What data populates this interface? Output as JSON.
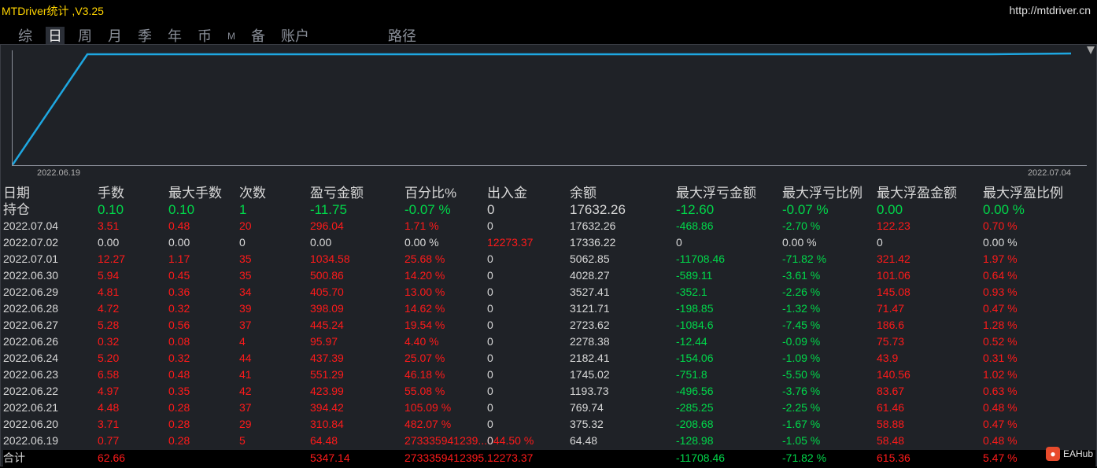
{
  "app": {
    "title": "MTDriver统计 ,V3.25",
    "url": "http://mtdriver.cn"
  },
  "tabs": [
    "综",
    "日",
    "周",
    "月",
    "季",
    "年",
    "币",
    "M",
    "备",
    "账户",
    "路径"
  ],
  "active_tab_index": 1,
  "chart_data": {
    "type": "line",
    "x_start_label": "2022.06.19",
    "x_end_label": "2022.07.04",
    "x": [
      "2022.06.19",
      "2022.06.20",
      "2022.06.21",
      "2022.06.22",
      "2022.06.23",
      "2022.06.24",
      "2022.06.26",
      "2022.06.27",
      "2022.06.28",
      "2022.06.29",
      "2022.06.30",
      "2022.07.01",
      "2022.07.02",
      "2022.07.04"
    ],
    "series": [
      {
        "values": [
          64.48,
          375.32,
          769.74,
          1193.73,
          1745.02,
          2182.41,
          2278.38,
          2723.62,
          3121.71,
          3527.41,
          4028.27,
          5062.85,
          17336.22,
          17632.26
        ]
      }
    ],
    "line_color": "#1ea7e1"
  },
  "table": {
    "headers": [
      "日期",
      "手数",
      "最大手数",
      "次数",
      "盈亏金额",
      "百分比%",
      "出入金",
      "余额",
      "最大浮亏金额",
      "最大浮亏比例",
      "最大浮盈金额",
      "最大浮盈比例"
    ],
    "holding": [
      "持仓",
      "0.10",
      "0.10",
      "1",
      "-11.75",
      "-0.07 %",
      "0",
      "17632.26",
      "-12.60",
      "-0.07 %",
      "0.00",
      "0.00 %"
    ],
    "rows": [
      [
        "2022.07.04",
        "3.51",
        "0.48",
        "20",
        "296.04",
        "1.71 %",
        "0",
        "17632.26",
        "-468.86",
        "-2.70 %",
        "122.23",
        "0.70 %"
      ],
      [
        "2022.07.02",
        "0.00",
        "0.00",
        "0",
        "0.00",
        "0.00 %",
        "12273.37",
        "17336.22",
        "0",
        "0.00 %",
        "0",
        "0.00 %"
      ],
      [
        "2022.07.01",
        "12.27",
        "1.17",
        "35",
        "1034.58",
        "25.68 %",
        "0",
        "5062.85",
        "-11708.46",
        "-71.82 %",
        "321.42",
        "1.97 %"
      ],
      [
        "2022.06.30",
        "5.94",
        "0.45",
        "35",
        "500.86",
        "14.20 %",
        "0",
        "4028.27",
        "-589.11",
        "-3.61 %",
        "101.06",
        "0.64 %"
      ],
      [
        "2022.06.29",
        "4.81",
        "0.36",
        "34",
        "405.70",
        "13.00 %",
        "0",
        "3527.41",
        "-352.1",
        "-2.26 %",
        "145.08",
        "0.93 %"
      ],
      [
        "2022.06.28",
        "4.72",
        "0.32",
        "39",
        "398.09",
        "14.62 %",
        "0",
        "3121.71",
        "-198.85",
        "-1.32 %",
        "71.47",
        "0.47 %"
      ],
      [
        "2022.06.27",
        "5.28",
        "0.56",
        "37",
        "445.24",
        "19.54 %",
        "0",
        "2723.62",
        "-1084.6",
        "-7.45 %",
        "186.6",
        "1.28 %"
      ],
      [
        "2022.06.26",
        "0.32",
        "0.08",
        "4",
        "95.97",
        "4.40 %",
        "0",
        "2278.38",
        "-12.44",
        "-0.09 %",
        "75.73",
        "0.52 %"
      ],
      [
        "2022.06.24",
        "5.20",
        "0.32",
        "44",
        "437.39",
        "25.07 %",
        "0",
        "2182.41",
        "-154.06",
        "-1.09 %",
        "43.9",
        "0.31 %"
      ],
      [
        "2022.06.23",
        "6.58",
        "0.48",
        "41",
        "551.29",
        "46.18 %",
        "0",
        "1745.02",
        "-751.8",
        "-5.50 %",
        "140.56",
        "1.02 %"
      ],
      [
        "2022.06.22",
        "4.97",
        "0.35",
        "42",
        "423.99",
        "55.08 %",
        "0",
        "1193.73",
        "-496.56",
        "-3.76 %",
        "83.67",
        "0.63 %"
      ],
      [
        "2022.06.21",
        "4.48",
        "0.28",
        "37",
        "394.42",
        "105.09 %",
        "0",
        "769.74",
        "-285.25",
        "-2.25 %",
        "61.46",
        "0.48 %"
      ],
      [
        "2022.06.20",
        "3.71",
        "0.28",
        "29",
        "310.84",
        "482.07 %",
        "0",
        "375.32",
        "-208.68",
        "-1.67 %",
        "58.88",
        "0.47 %"
      ],
      [
        "2022.06.19",
        "0.77",
        "0.28",
        "5",
        "64.48",
        "273335941239...044.50 %",
        "0",
        "64.48",
        "-128.98",
        "-1.05 %",
        "58.48",
        "0.48 %"
      ]
    ],
    "total": [
      "合计",
      "62.66",
      "",
      "",
      "5347.14",
      "2733359412395...",
      "12273.37",
      "",
      "-11708.46",
      "-71.82 %",
      "615.36",
      "5.47 %"
    ]
  },
  "colors": {
    "positive": "#ff1a1a",
    "negative": "#00d84a",
    "neutral": "#d9d9d9"
  },
  "watermark": {
    "text": "EAHub",
    "icon": "eahub-logo-icon"
  }
}
